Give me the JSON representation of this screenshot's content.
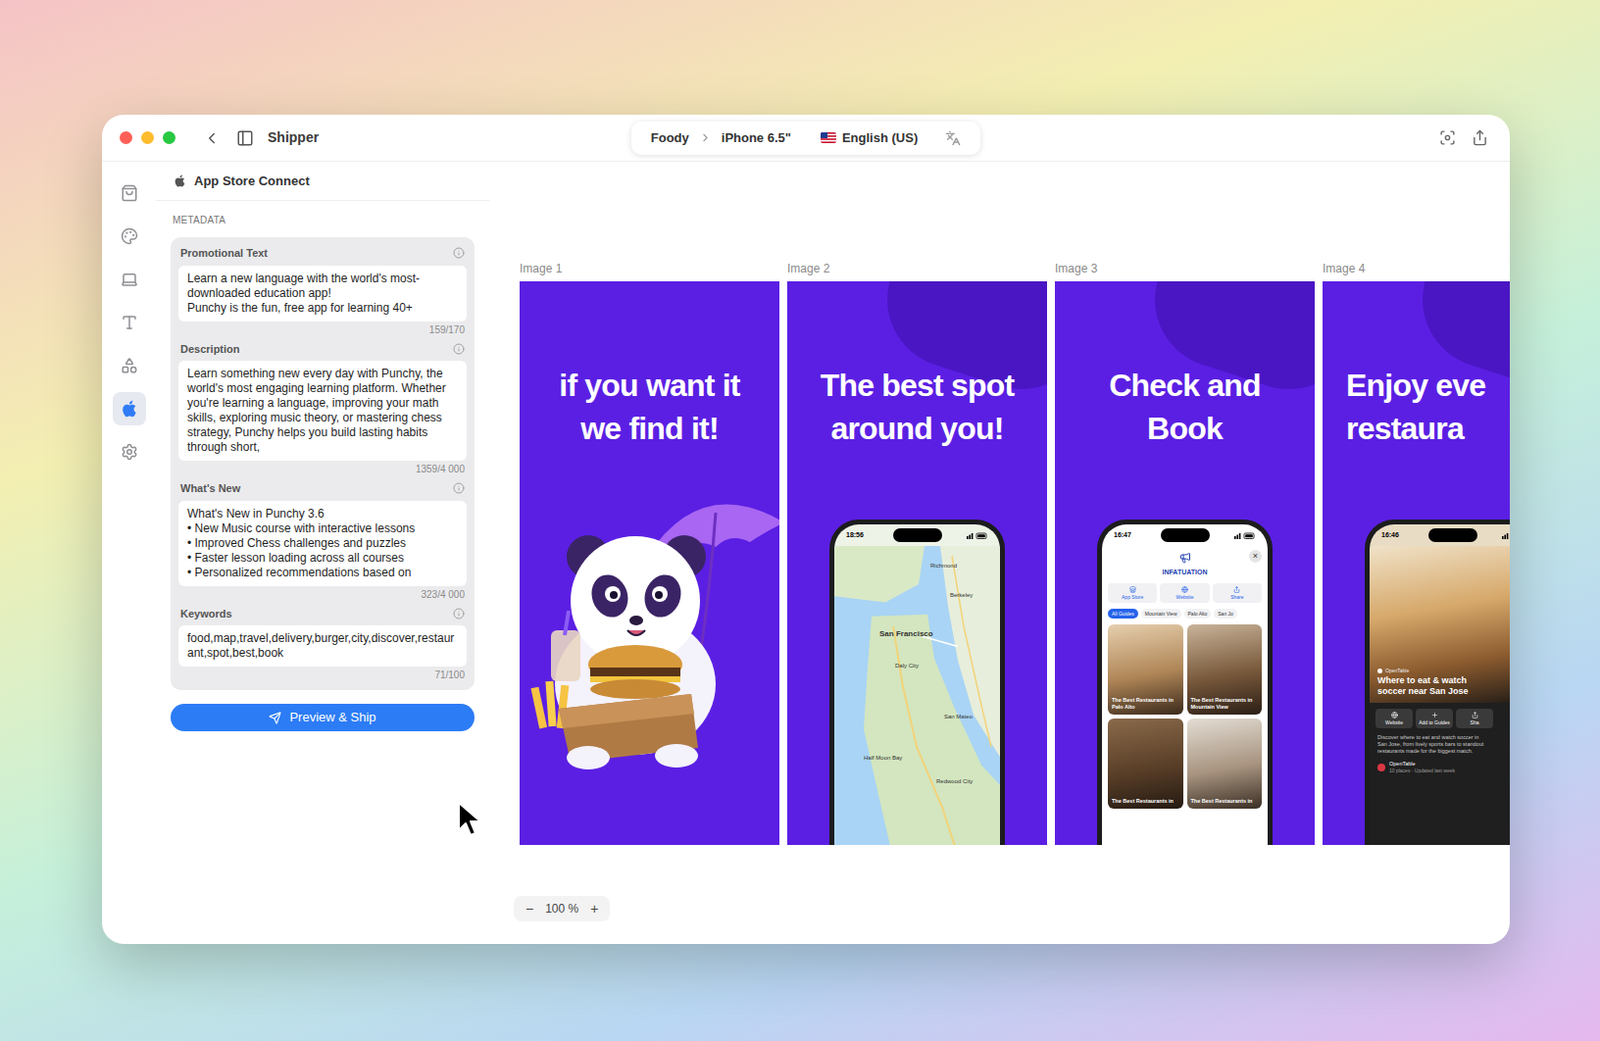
{
  "window": {
    "title": "Shipper"
  },
  "breadcrumb": {
    "app": "Foody",
    "device": "iPhone 6.5\"",
    "language": "English (US)"
  },
  "rail": [
    {
      "selected": false
    },
    {
      "selected": false
    },
    {
      "selected": false
    },
    {
      "selected": false
    },
    {
      "selected": false
    },
    {
      "selected": true
    },
    {
      "selected": false
    }
  ],
  "panel": {
    "title": "App Store Connect",
    "section": "METADATA",
    "fields": [
      {
        "label": "Promotional Text",
        "value": "Learn a new language with the world's most-downloaded education app!\nPunchy is the fun, free app for learning 40+",
        "count": "159/170"
      },
      {
        "label": "Description",
        "value": "Learn something new every day with Punchy, the world's most engaging learning platform. Whether you're learning a language, improving your math skills, exploring music theory, or mastering chess strategy, Punchy helps you build lasting habits through short,",
        "count": "1359/4 000"
      },
      {
        "label": "What's New",
        "value": "What's New in Punchy 3.6\n• New Music course with interactive lessons\n• Improved Chess challenges and puzzles\n• Faster lesson loading across all courses\n• Personalized recommendations based on",
        "count": "323/4 000"
      },
      {
        "label": "Keywords",
        "value": "food,map,travel,delivery,burger,city,discover,restaurant,spot,best,book",
        "count": "71/100"
      }
    ],
    "button": "Preview & Ship"
  },
  "canvas": {
    "zoom": "100 %",
    "zoom_out": "−",
    "zoom_in": "+",
    "images": [
      {
        "label": "Image 1",
        "kind": "illustration",
        "headline": [
          "if you want it",
          "we find it!"
        ]
      },
      {
        "label": "Image 2",
        "kind": "map",
        "headline": [
          "The best spot",
          "around you!"
        ],
        "phone": {
          "time": "18:56",
          "places": [
            "Richmond",
            "Berkeley",
            "San Francisco",
            "Daly City",
            "San Mateo",
            "Half Moon Bay",
            "Redwood City"
          ]
        }
      },
      {
        "label": "Image 3",
        "kind": "guides",
        "headline": [
          "Check and",
          "Book"
        ],
        "phone": {
          "time": "16:47",
          "close": "×",
          "brand": "INFATUATION",
          "actions": [
            "App Store",
            "Website",
            "Share"
          ],
          "chips": [
            {
              "label": "All Guides",
              "selected": true
            },
            {
              "label": "Mountain View",
              "selected": false
            },
            {
              "label": "Palo Alto",
              "selected": false
            },
            {
              "label": "San Jo",
              "selected": false
            }
          ],
          "tiles": [
            "The Best Restaurants in Palo Alto",
            "The Best Restaurants in Mountain View",
            "The Best Restaurants in",
            "The Best Restaurants in"
          ]
        }
      },
      {
        "label": "Image 4",
        "kind": "place",
        "headline": [
          "Enjoy eve",
          "restaura"
        ],
        "phone": {
          "time": "16:46",
          "source": "OpenTable",
          "title": "Where to eat & watch soccer near San Jose",
          "actions": [
            "Website",
            "Add to Guides",
            "Sha"
          ],
          "description": "Discover where to eat and watch soccer in San Jose, from lively sports bars to standout restaurants made for the biggest match.",
          "footer_title": "OpenTable",
          "footer_meta": "10 places · Updated last week"
        }
      }
    ]
  }
}
